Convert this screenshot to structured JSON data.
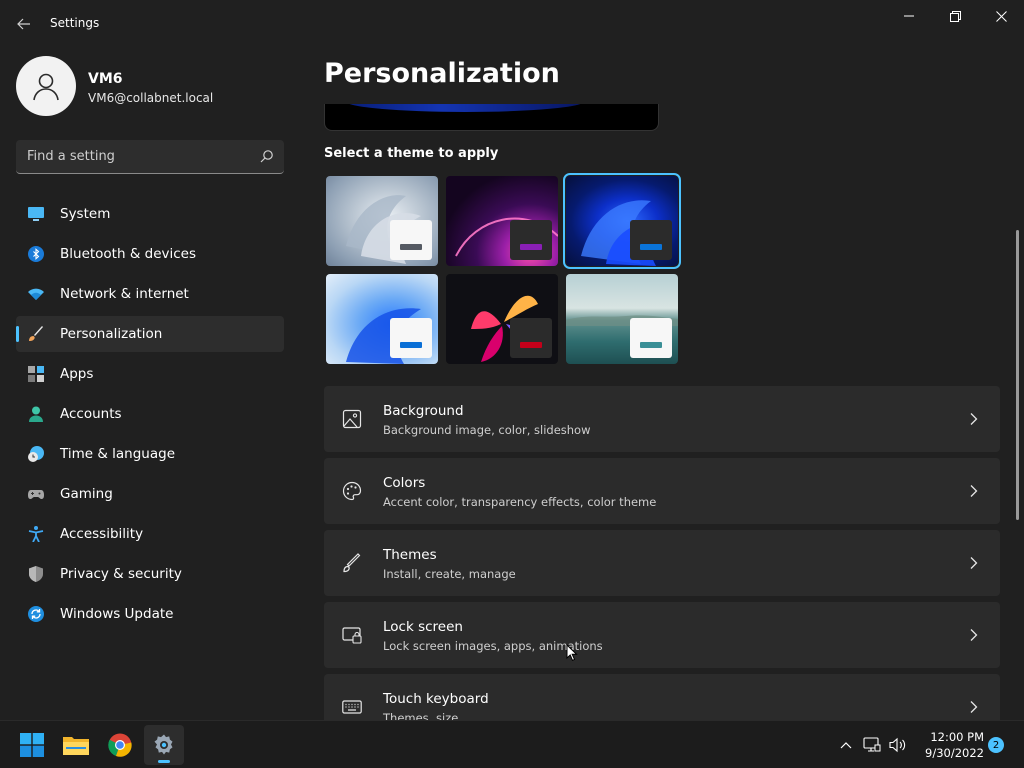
{
  "window": {
    "title": "Settings",
    "controls": {
      "minimize": "minimize",
      "maximize": "restore",
      "close": "close"
    }
  },
  "profile": {
    "name": "VM6",
    "email": "VM6@collabnet.local"
  },
  "search": {
    "placeholder": "Find a setting"
  },
  "nav": {
    "selected": "Personalization",
    "items": [
      {
        "label": "System",
        "icon": "monitor-icon"
      },
      {
        "label": "Bluetooth & devices",
        "icon": "bluetooth-icon"
      },
      {
        "label": "Network & internet",
        "icon": "wifi-icon"
      },
      {
        "label": "Personalization",
        "icon": "brush-icon"
      },
      {
        "label": "Apps",
        "icon": "apps-icon"
      },
      {
        "label": "Accounts",
        "icon": "person-icon"
      },
      {
        "label": "Time & language",
        "icon": "clock-globe-icon"
      },
      {
        "label": "Gaming",
        "icon": "gamepad-icon"
      },
      {
        "label": "Accessibility",
        "icon": "accessibility-icon"
      },
      {
        "label": "Privacy & security",
        "icon": "shield-icon"
      },
      {
        "label": "Windows Update",
        "icon": "update-icon"
      }
    ]
  },
  "main": {
    "page_title": "Personalization",
    "themes_label": "Select a theme to apply",
    "themes": [
      {
        "name": "windows-light-bloom",
        "selected": false,
        "bar_color": "#555a63"
      },
      {
        "name": "glow-purple",
        "selected": false,
        "bar_color": "#8a1fb6"
      },
      {
        "name": "windows-dark-bloom",
        "selected": true,
        "bar_color": "#0a74da"
      },
      {
        "name": "windows-light-blue",
        "selected": false,
        "bar_color": "#0a6fd6"
      },
      {
        "name": "captured-motion",
        "selected": false,
        "bar_color": "#c4001a"
      },
      {
        "name": "flow-lake",
        "selected": false,
        "bar_color": "#3a8f96"
      }
    ],
    "cards": [
      {
        "title": "Background",
        "subtitle": "Background image, color, slideshow",
        "icon": "image-icon"
      },
      {
        "title": "Colors",
        "subtitle": "Accent color, transparency effects, color theme",
        "icon": "palette-icon"
      },
      {
        "title": "Themes",
        "subtitle": "Install, create, manage",
        "icon": "pen-icon"
      },
      {
        "title": "Lock screen",
        "subtitle": "Lock screen images, apps, animations",
        "icon": "lock-screen-icon"
      },
      {
        "title": "Touch keyboard",
        "subtitle": "Themes, size",
        "icon": "keyboard-icon"
      }
    ]
  },
  "taskbar": {
    "apps": [
      "start-icon",
      "file-explorer-icon",
      "chrome-icon",
      "settings-icon"
    ],
    "clock_time": "12:00 PM",
    "clock_date": "9/30/2022",
    "notification_count": "2"
  },
  "colors": {
    "accent": "#4cc2ff",
    "background": "#202020",
    "card": "#2b2b2b"
  }
}
